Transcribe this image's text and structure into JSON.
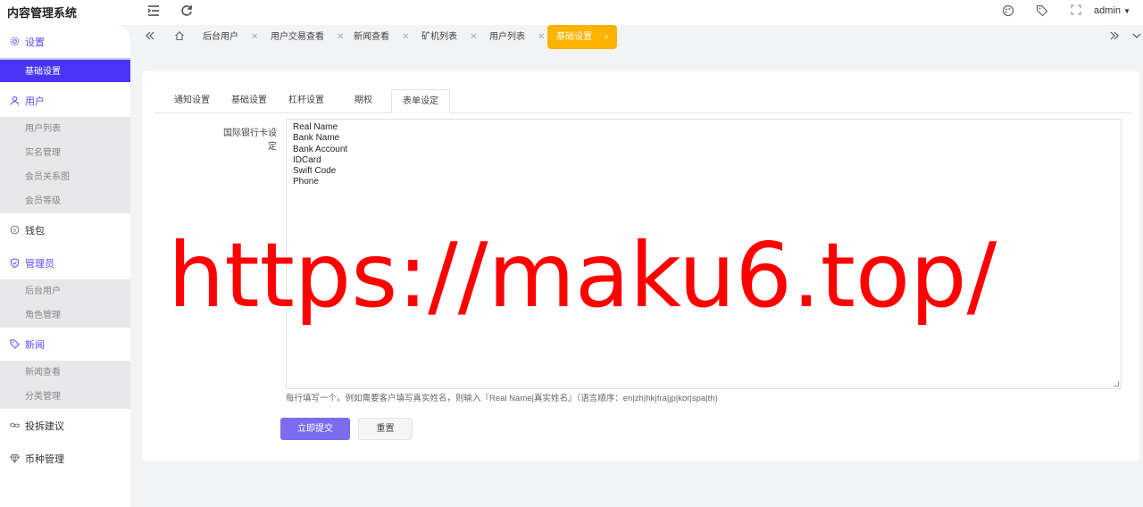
{
  "app": {
    "title": "内容管理系统",
    "user": "admin"
  },
  "sidebar": {
    "groups": [
      {
        "label": "设置",
        "icon": "gear-icon",
        "active": true,
        "items": [
          {
            "label": "基础设置",
            "active": true
          }
        ]
      },
      {
        "label": "用户",
        "icon": "user-icon",
        "active": true,
        "items": [
          {
            "label": "用户列表"
          },
          {
            "label": "实名管理"
          },
          {
            "label": "会员关系图"
          },
          {
            "label": "会员等级"
          }
        ]
      },
      {
        "label": "钱包",
        "icon": "coin-icon",
        "active": false,
        "items": []
      },
      {
        "label": "管理员",
        "icon": "shield-icon",
        "active": true,
        "items": [
          {
            "label": "后台用户"
          },
          {
            "label": "角色管理"
          }
        ]
      },
      {
        "label": "新闻",
        "icon": "tag-icon",
        "active": true,
        "items": [
          {
            "label": "新闻查看"
          },
          {
            "label": "分类管理"
          }
        ]
      },
      {
        "label": "投拆建议",
        "icon": "link-icon",
        "active": false,
        "items": []
      },
      {
        "label": "币种管理",
        "icon": "diamond-icon",
        "active": false,
        "items": []
      }
    ]
  },
  "tabs": [
    {
      "label": "后台用户"
    },
    {
      "label": "用户交易查看"
    },
    {
      "label": "新闻查看"
    },
    {
      "label": "矿机列表"
    },
    {
      "label": "用户列表"
    },
    {
      "label": "基础设置",
      "active": true
    }
  ],
  "inner_tabs": [
    "通知设置",
    "基础设置",
    "杠杆设置",
    "期权",
    "表单设定"
  ],
  "form": {
    "label": "国际银行卡设定",
    "lines": [
      "Real Name",
      "Bank Name",
      "Bank Account",
      "IDCard",
      "Swift Code",
      "Phone"
    ],
    "hint": "每行填写一个。例如需要客户填写真实姓名，则输入『Real Name|真实姓名』（语言顺序：en|zh|hk|fra|jp|kor|spa|th)",
    "submit_label": "立即提交",
    "reset_label": "重置"
  },
  "watermark": "https://maku6.top/",
  "colors": {
    "accent": "#4a35f7",
    "tab_active": "#ffb300",
    "primary_button": "#7c6cf0",
    "watermark": "#ff0000"
  }
}
